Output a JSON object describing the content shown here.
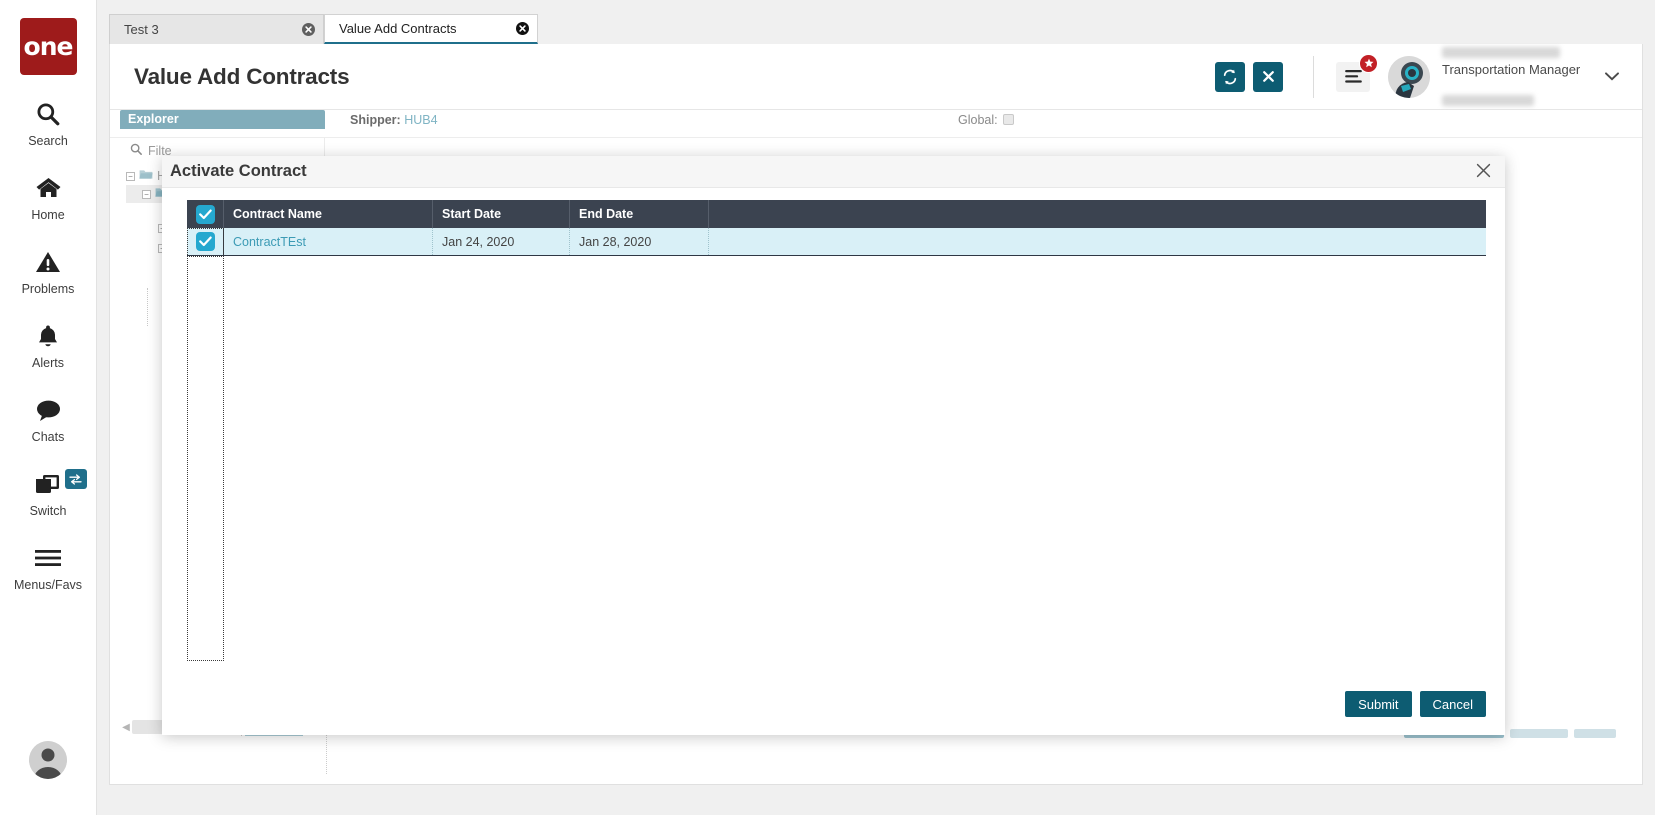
{
  "app": {
    "logo_text": "one",
    "rail_items": [
      {
        "label": "Search",
        "icon": "search-icon"
      },
      {
        "label": "Home",
        "icon": "home-icon"
      },
      {
        "label": "Problems",
        "icon": "warning-triangle-icon"
      },
      {
        "label": "Alerts",
        "icon": "bell-icon"
      },
      {
        "label": "Chats",
        "icon": "chat-bubble-icon"
      },
      {
        "label": "Switch",
        "icon": "windows-stack-icon"
      },
      {
        "label": "Menus/Favs",
        "icon": "hamburger-icon"
      }
    ]
  },
  "tabs": [
    {
      "label": "Test 3",
      "active": false
    },
    {
      "label": "Value Add Contracts",
      "active": true
    }
  ],
  "header": {
    "title": "Value Add Contracts",
    "refresh_icon": "refresh-icon",
    "close_icon": "close-x-icon",
    "menu_icon": "hamburger-menu-icon",
    "badge_icon": "star-badge-icon",
    "avatar_icon": "user-avatar",
    "user_role": "Transportation Manager",
    "caret_icon": "chevron-down-icon"
  },
  "subbar": {
    "explorer_tab_label": "Explorer",
    "shipper_label": "Shipper:",
    "shipper_value": "HUB4",
    "global_label": "Global:"
  },
  "explorer": {
    "filter_placeholder": "Filter",
    "filter_label": "Filte",
    "search_icon": "search-icon",
    "nodes": [
      {
        "label": "HU",
        "expander": "-",
        "icon": "folder-open-icon",
        "indent": 0,
        "selected": false
      },
      {
        "label": "",
        "expander": "-",
        "icon": "folder-open-icon",
        "indent": 1,
        "selected": true
      },
      {
        "label": "",
        "expander": "+",
        "icon": "",
        "indent": 2,
        "selected": false
      },
      {
        "label": "",
        "expander": "+",
        "icon": "",
        "indent": 2,
        "selected": false
      }
    ]
  },
  "modal": {
    "title": "Activate Contract",
    "close_icon": "close-icon",
    "columns": [
      "",
      "Contract Name",
      "Start Date",
      "End Date",
      ""
    ],
    "header_select_all_checked": true,
    "rows": [
      {
        "checked": true,
        "contract_name": "ContractTEst",
        "start_date": "Jan 24, 2020",
        "end_date": "Jan 28, 2020"
      }
    ],
    "submit_label": "Submit",
    "cancel_label": "Cancel"
  },
  "colors": {
    "brand_red": "#9e1b1b",
    "accent_teal": "#0d5c72",
    "checkbox_blue": "#25a8cf",
    "grid_header": "#3b4350",
    "row_highlight": "#d9f0f7",
    "explorer_tab": "#81adbb",
    "badge_red": "#c22026",
    "link_blue": "#3c9bb5"
  }
}
